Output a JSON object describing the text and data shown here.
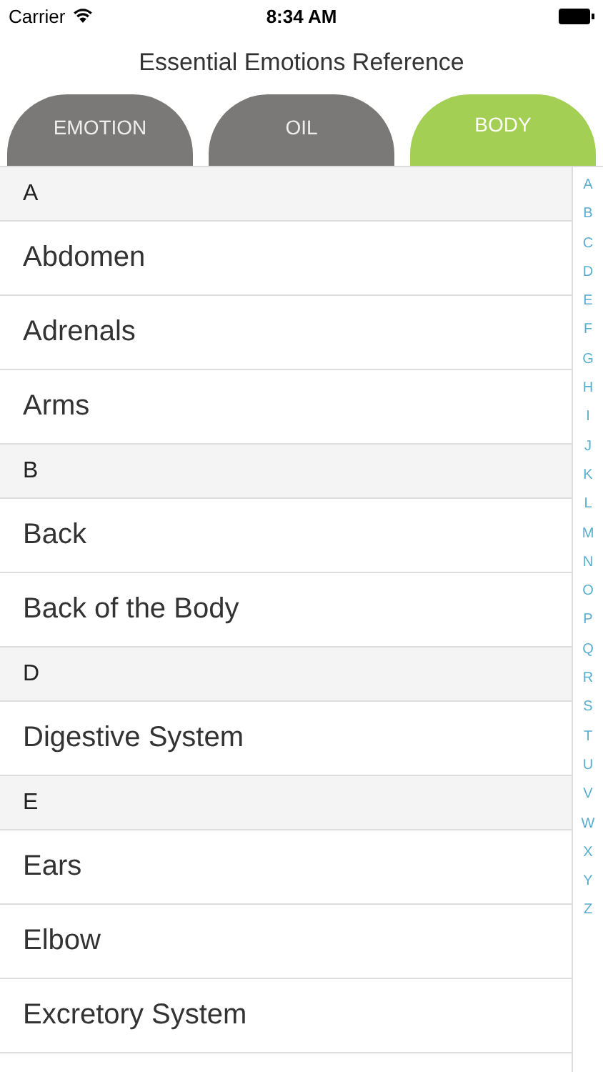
{
  "status_bar": {
    "carrier": "Carrier",
    "time": "8:34 AM"
  },
  "title": "Essential Emotions Reference",
  "tabs": [
    {
      "label": "EMOTION",
      "selected": false
    },
    {
      "label": "OIL",
      "selected": false
    },
    {
      "label": "BODY",
      "selected": true
    }
  ],
  "sections": [
    {
      "letter": "A",
      "items": [
        "Abdomen",
        "Adrenals",
        "Arms"
      ]
    },
    {
      "letter": "B",
      "items": [
        "Back",
        "Back of the Body"
      ]
    },
    {
      "letter": "D",
      "items": [
        "Digestive System"
      ]
    },
    {
      "letter": "E",
      "items": [
        "Ears",
        "Elbow",
        "Excretory System"
      ]
    }
  ],
  "index": [
    "A",
    "B",
    "C",
    "D",
    "E",
    "F",
    "G",
    "H",
    "I",
    "J",
    "K",
    "L",
    "M",
    "N",
    "O",
    "P",
    "Q",
    "R",
    "S",
    "T",
    "U",
    "V",
    "W",
    "X",
    "Y",
    "Z"
  ]
}
